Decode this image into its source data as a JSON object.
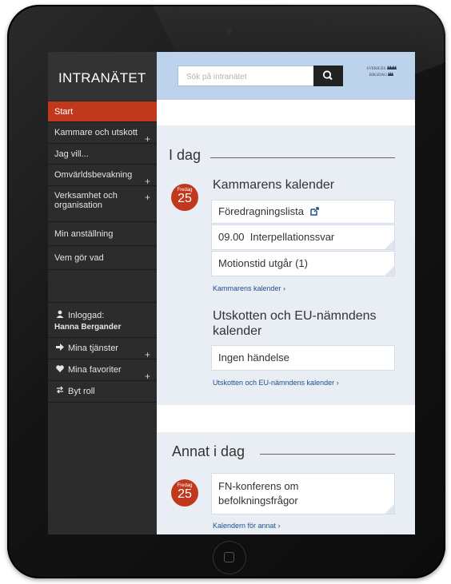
{
  "sidebar": {
    "brand": "INTRANÄTET",
    "items": [
      {
        "label": "Start",
        "plus": ""
      },
      {
        "label": "Kammare och utskott",
        "plus": "+"
      },
      {
        "label": "Jag vill...",
        "plus": ""
      },
      {
        "label": "Omvärldsbevakning",
        "plus": "+"
      },
      {
        "label": "Verksamhet och organisation",
        "plus": "+"
      },
      {
        "label": "Min anställning",
        "plus": ""
      },
      {
        "label": "Vem gör vad",
        "plus": ""
      }
    ],
    "user": {
      "label": "Inloggad:",
      "name": "Hanna Bergander"
    },
    "services": {
      "label": "Mina tjänster",
      "plus": "+"
    },
    "favorites": {
      "label": "Mina favoriter",
      "plus": "+"
    },
    "role": {
      "label": "Byt roll"
    }
  },
  "search": {
    "placeholder": "Sök på intranätet"
  },
  "logo": {
    "line1": "SVERIGES",
    "line2": "RIKSDAG"
  },
  "today": {
    "heading": "I dag",
    "date_day": "Fredag",
    "date_num": "25",
    "chamber_title": "Kammarens kalender",
    "chamber_items": [
      "Föredragningslista",
      "09.00  Interpellationssvar",
      "Motionstid utgår (1)"
    ],
    "chamber_link": "Kammarens kalender ›",
    "committee_title": "Utskotten och EU-nämndens kalender",
    "committee_item": "Ingen händelse",
    "committee_link": "Utskotten och EU-nämndens kalender ›"
  },
  "other": {
    "heading": "Annat i dag",
    "date_day": "Fredag",
    "date_num": "25",
    "item": "FN-konferens om befolkningsfrågor",
    "link": "Kalendern för annat ›"
  },
  "colors": {
    "accent": "#c0391c",
    "sidebar": "#2c2c2c",
    "topbar": "#bcd3eb",
    "link": "#1d4f8c"
  },
  "icons": [
    "search-icon",
    "external-link-icon",
    "user-icon",
    "arrow-right-icon",
    "heart-icon",
    "swap-icon",
    "home-button-icon"
  ]
}
